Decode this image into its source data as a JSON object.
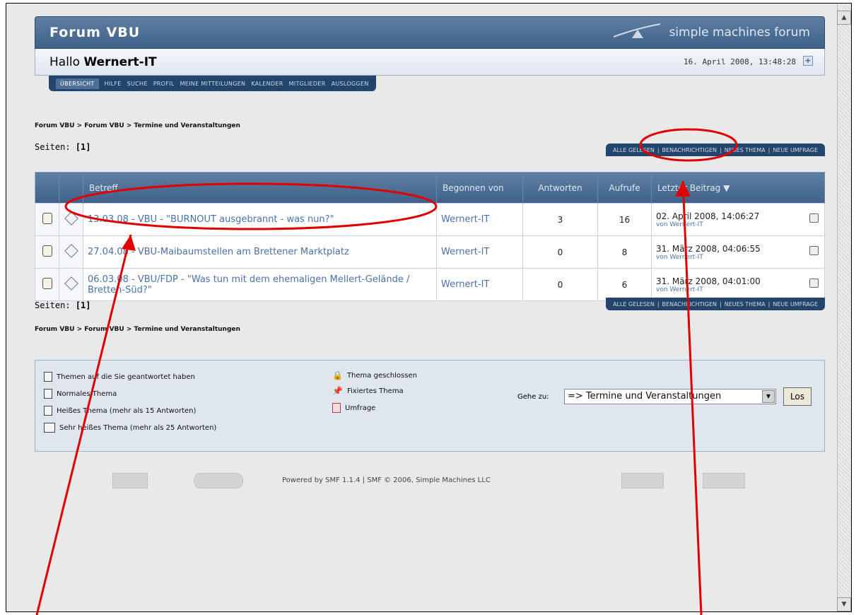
{
  "header": {
    "site_title": "Forum VBU",
    "smf_logo": "simple machines forum"
  },
  "userbar": {
    "greeting": "Hallo",
    "username": "Wernert-IT",
    "datetime": "16. April 2008, 13:48:28"
  },
  "menu": [
    {
      "label": "ÜBERSICHT",
      "active": true
    },
    {
      "label": "HILFE"
    },
    {
      "label": "SUCHE"
    },
    {
      "label": "PROFIL"
    },
    {
      "label": "MEINE MITTEILUNGEN"
    },
    {
      "label": "KALENDER"
    },
    {
      "label": "MITGLIEDER"
    },
    {
      "label": "AUSLOGGEN"
    }
  ],
  "breadcrumb": "Forum VBU > Forum VBU > Termine und Veranstaltungen",
  "pages": {
    "label": "Seiten:",
    "value": "[1]"
  },
  "actions_top": [
    "ALLE GELESEN",
    "BENACHRICHTIGEN",
    "NEUES THEMA",
    "NEUE UMFRAGE"
  ],
  "actions_bottom": [
    "ALLE GELESEN",
    "BENACHRICHTIGEN",
    "NEUES THEMA",
    "NEUE UMFRAGE"
  ],
  "table": {
    "columns": {
      "subject": "Betreff",
      "started_by": "Begonnen von",
      "replies": "Antworten",
      "views": "Aufrufe",
      "last_post": "Letzter Beitrag"
    },
    "rows": [
      {
        "subject": "13.03.08 - VBU - \"BURNOUT ausgebrannt - was nun?\"",
        "started_by": "Wernert-IT",
        "replies": "3",
        "views": "16",
        "last_date": "02. April 2008, 14:06:27",
        "last_by": "von Wernert-IT"
      },
      {
        "subject": "27.04.08 - VBU-Maibaumstellen am Brettener Marktplatz",
        "started_by": "Wernert-IT",
        "replies": "0",
        "views": "8",
        "last_date": "31. März 2008, 04:06:55",
        "last_by": "von Wernert-IT"
      },
      {
        "subject": "06.03.08 - VBU/FDP - \"Was tun mit dem ehemaligen Mellert-Gelände / Bretten-Süd?\"",
        "started_by": "Wernert-IT",
        "replies": "0",
        "views": "6",
        "last_date": "31. März 2008, 04:01:00",
        "last_by": "von Wernert-IT"
      }
    ]
  },
  "legend": {
    "replied": "Themen auf die Sie geantwortet haben",
    "normal": "Normales Thema",
    "hot": "Heißes Thema (mehr als 15 Antworten)",
    "very_hot": "Sehr heißes Thema (mehr als 25 Antworten)",
    "locked": "Thema geschlossen",
    "sticky": "Fixiertes Thema",
    "poll": "Umfrage"
  },
  "jump": {
    "label": "Gehe zu:",
    "selected": "=> Termine und Veranstaltungen",
    "button": "Los"
  },
  "footer": {
    "powered": "Powered by SMF 1.1.4 | SMF © 2006, Simple Machines LLC"
  },
  "colors": {
    "header_blue": "#3f6088",
    "menu_blue": "#23446b",
    "link_blue": "#4a72a8",
    "annotation_red": "#e00000"
  }
}
